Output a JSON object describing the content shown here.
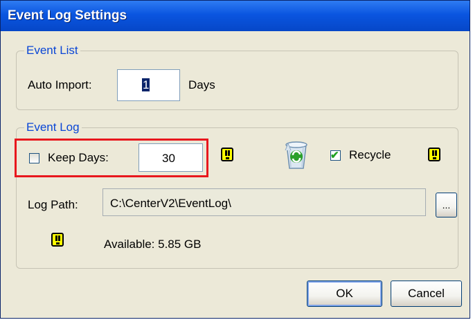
{
  "window": {
    "title": "Event Log Settings"
  },
  "event_list": {
    "legend": "Event List",
    "auto_import_label": "Auto Import:",
    "auto_import_value": "1",
    "days_label": "Days"
  },
  "event_log": {
    "legend": "Event Log",
    "keep_days_label": "Keep Days:",
    "keep_days_checked": false,
    "keep_days_value": "30",
    "recycle_label": "Recycle",
    "recycle_checked": true,
    "log_path_label": "Log Path:",
    "log_path_value": "C:\\CenterV2\\EventLog\\",
    "browse_label": "...",
    "available_text": "Available: 5.85 GB"
  },
  "buttons": {
    "ok": "OK",
    "cancel": "Cancel"
  },
  "icons": {
    "warning": "warning-exclamation-icon",
    "recycle": "recycle-bin-icon",
    "checkbox_checked": "checkmark-icon"
  },
  "colors": {
    "titlebar": "#0a55e0",
    "legend": "#0a46d6",
    "highlight": "#e8171d",
    "warning": "#ffff00",
    "dialog_bg": "#ece9d8"
  }
}
